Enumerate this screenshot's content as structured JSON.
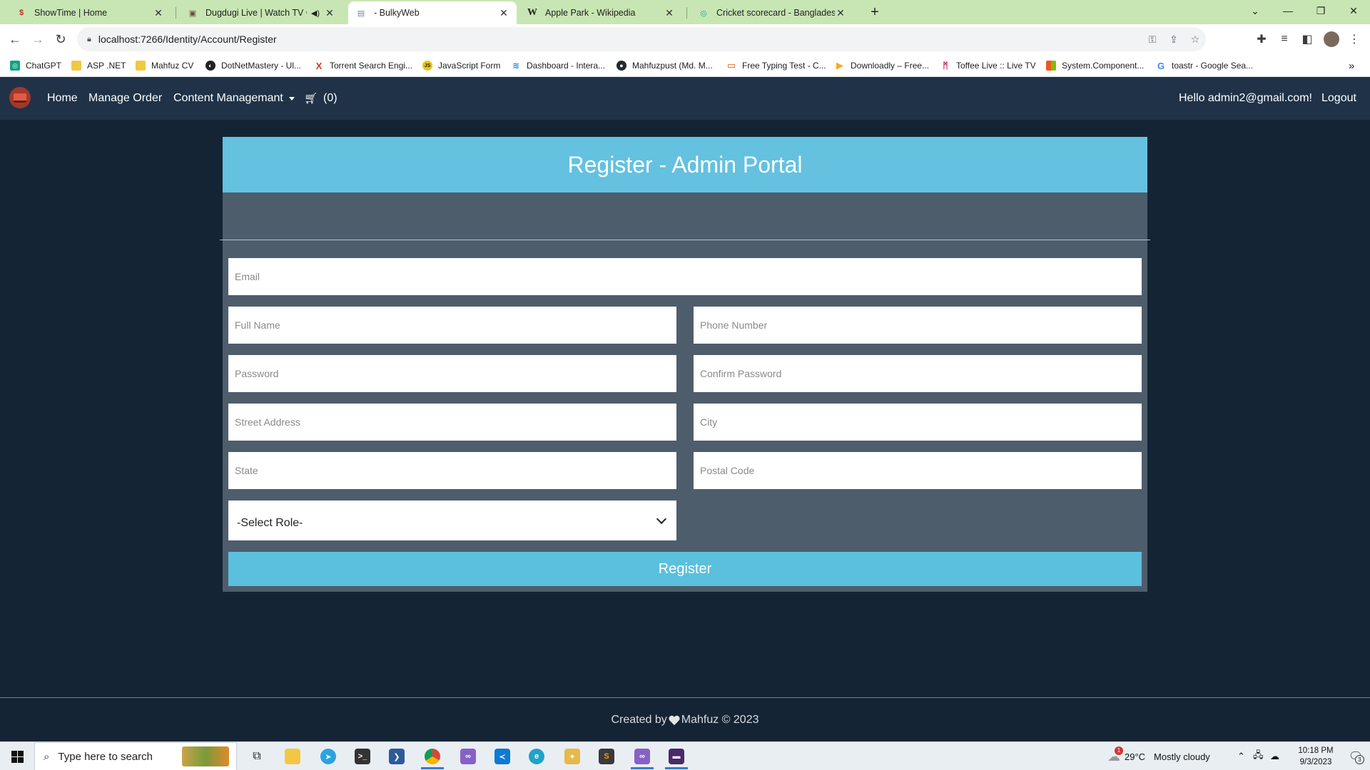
{
  "browser": {
    "tabs": [
      {
        "title": "ShowTime | Home",
        "icon": "showtime-favicon"
      },
      {
        "title": "Dugdugi Live | Watch TV Onl",
        "icon": "tv-favicon",
        "audio": "speaker-icon"
      },
      {
        "title": "- BulkyWeb",
        "icon": "page-favicon",
        "active": true
      },
      {
        "title": "Apple Park - Wikipedia",
        "icon": "wikipedia-favicon"
      },
      {
        "title": "Cricket scorecard - Bangladesh v",
        "icon": "cricket-favicon"
      }
    ],
    "new_tab_symbol": "+",
    "url": "localhost:7266/Identity/Account/Register",
    "bookmarks": [
      {
        "label": "ChatGPT",
        "color": "#10a37f"
      },
      {
        "label": "ASP .NET",
        "color": "#f2c744"
      },
      {
        "label": "Mahfuz CV",
        "color": "#f2c744"
      },
      {
        "label": "DotNetMastery - Ul...",
        "color": "#222222"
      },
      {
        "label": "Torrent Search Engi...",
        "color": "#d9381e"
      },
      {
        "label": "JavaScript Form",
        "color": "#e6c519"
      },
      {
        "label": "Dashboard - Intera...",
        "color": "#1e88e5"
      },
      {
        "label": "Mahfuzpust (Md. M...",
        "color": "#24292e"
      },
      {
        "label": "Free Typing Test - C...",
        "color": "#e65100"
      },
      {
        "label": "Downloadly – Free...",
        "color": "#f9a825"
      },
      {
        "label": "Toffee Live :: Live TV",
        "color": "#c2185b"
      },
      {
        "label": "System.Component...",
        "color": "#f35325"
      },
      {
        "label": "toastr - Google Sea...",
        "color": "#4285f4"
      }
    ],
    "overflow_symbol": "»"
  },
  "navbar": {
    "home": "Home",
    "manage_order": "Manage Order",
    "content_management": "Content Managemant",
    "cart_count": "(0)",
    "greeting": "Hello admin2@gmail.com!",
    "logout": "Logout"
  },
  "register": {
    "title": "Register - Admin Portal",
    "email_placeholder": "Email",
    "full_name_placeholder": "Full Name",
    "phone_placeholder": "Phone Number",
    "password_placeholder": "Password",
    "confirm_password_placeholder": "Confirm Password",
    "street_placeholder": "Street Address",
    "city_placeholder": "City",
    "state_placeholder": "State",
    "postal_placeholder": "Postal Code",
    "role_selected": "-Select Role-",
    "submit_label": "Register"
  },
  "footer": {
    "prefix": "Created by",
    "suffix": "Mahfuz © 2023"
  },
  "taskbar": {
    "search_placeholder": "Type here to search",
    "weather_temp": "29°C",
    "weather_desc": "Mostly cloudy",
    "time": "10:18 PM",
    "date": "9/3/2023",
    "notification_count": "3",
    "weather_badge": "1"
  },
  "colors": {
    "navbar_bg": "#1f3247",
    "page_bg": "#152434",
    "card_bg": "#4e5d6c",
    "header_accent": "#64c1e0",
    "button_accent": "#5bc0de",
    "tabstrip_bg": "#c8e6b3"
  }
}
